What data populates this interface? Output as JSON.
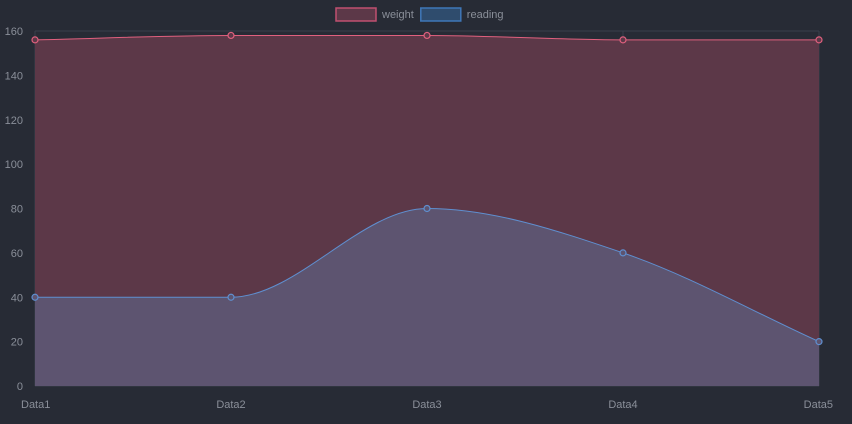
{
  "chart_data": {
    "type": "area",
    "categories": [
      "Data1",
      "Data2",
      "Data3",
      "Data4",
      "Data5"
    ],
    "series": [
      {
        "name": "weight",
        "values": [
          156,
          158,
          158,
          156,
          156
        ],
        "line_color": "#e0607e",
        "fill_color": "#5c3848"
      },
      {
        "name": "reading",
        "values": [
          40,
          40,
          80,
          60,
          20
        ],
        "line_color": "#5f8fd0",
        "fill_color": "#5d5470"
      }
    ],
    "ylim": [
      0,
      160
    ],
    "y_ticks": [
      0,
      20,
      40,
      60,
      80,
      100,
      120,
      140,
      160
    ],
    "grid": true,
    "legend_position": "top-center",
    "title": "",
    "xlabel": "",
    "ylabel": ""
  },
  "colors": {
    "background": "#272b35",
    "grid": "#3a3f4b",
    "axis_text": "#8a8f99",
    "legend_text": "#8a8f99",
    "legend_weight_border": "#c05070",
    "legend_weight_fill": "#5c3848",
    "legend_reading_border": "#3f77b8",
    "legend_reading_fill": "#2f4c6d"
  }
}
